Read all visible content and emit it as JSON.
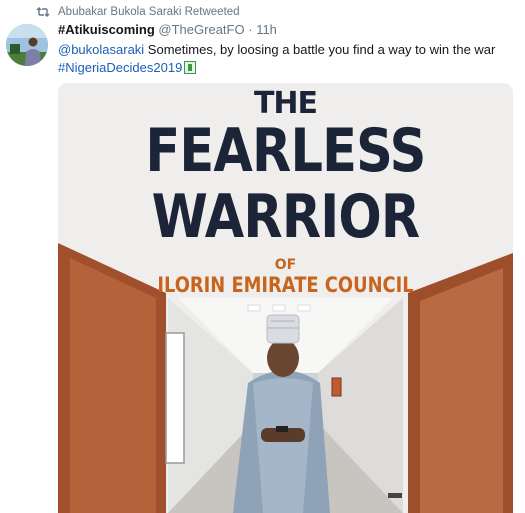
{
  "retweet": {
    "label": "Abubakar Bukola Saraki Retweeted",
    "icon": "retweet-icon"
  },
  "tweet": {
    "display_name": "#Atikuiscoming",
    "handle": "@TheGreatFO",
    "separator": "·",
    "time": "11h",
    "mention": "@bukolasaraki",
    "body": " Sometimes, by loosing a battle you find a way to win the war",
    "hashtag": "#NigeriaDecides2019",
    "emoji": "ballot-box-icon"
  },
  "media": {
    "line1": "THE",
    "line2": "FEARLESS",
    "line3": "WARRIOR",
    "line4": "OF",
    "line5": "ILORIN EMIRATE COUNCIL"
  },
  "colors": {
    "link": "#1b5fb8",
    "muted": "#657786",
    "poster_navy": "#1c2437",
    "poster_orange": "#c8641e"
  }
}
